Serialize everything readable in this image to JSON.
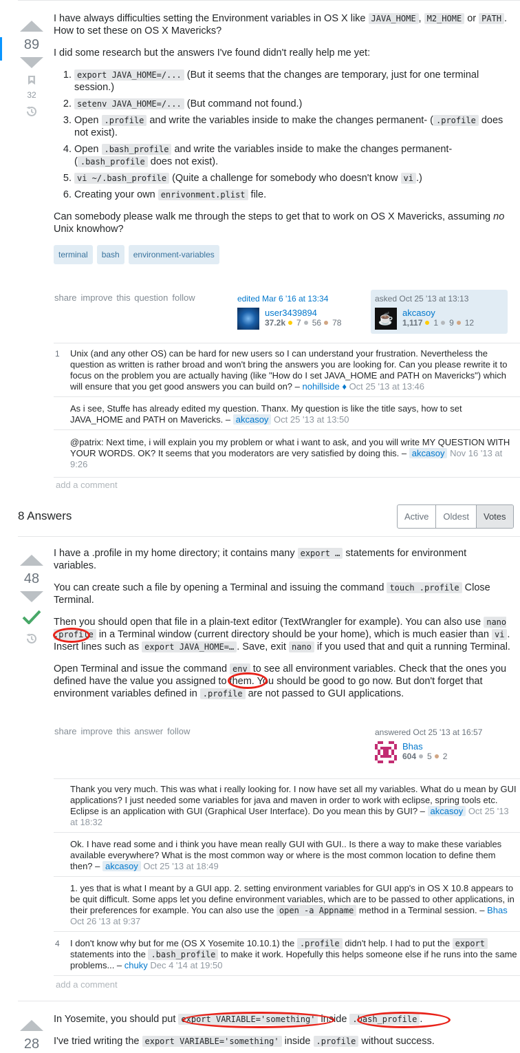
{
  "question": {
    "votes": "89",
    "bookmarks": "32",
    "intro_1": "I have always difficulties setting the Environment variables in OS X like ",
    "intro_code_1": "JAVA_HOME",
    "intro_sep_1": ", ",
    "intro_code_2": "M2_HOME",
    "intro_sep_2": " or ",
    "intro_code_3": "PATH",
    "intro_2": ". How to set these on OS X Mavericks?",
    "research": "I did some research but the answers I've found didn't really help me yet:",
    "steps": [
      {
        "pre": "",
        "code": "export JAVA_HOME=/...",
        "post": " (But it seems that the changes are temporary, just for one terminal session.)"
      },
      {
        "pre": "",
        "code": "setenv JAVA_HOME=/...",
        "post": " (But command not found.)"
      },
      {
        "pre": "Open ",
        "code": ".profile",
        "mid": " and write the variables inside to make the changes permanent- (",
        "code2": ".profile",
        "post": " does not exist)."
      },
      {
        "pre": "Open ",
        "code": ".bash_profile",
        "mid": " and write the variables inside to make the changes permanent- (",
        "code2": ".bash_profile",
        "post": " does not exist)."
      },
      {
        "pre": "",
        "code": "vi ~/.bash_profile",
        "mid": " (Quite a challenge for somebody who doesn't know ",
        "code2": "vi",
        "post": ".)"
      },
      {
        "pre": "Creating your own ",
        "code": "enrivonment.plist",
        "post": " file."
      }
    ],
    "closing_1": "Can somebody please walk me through the steps to get that to work on OS X Mavericks, assuming ",
    "closing_em": "no",
    "closing_2": " Unix knowhow?",
    "tags": [
      "terminal",
      "bash",
      "environment-variables"
    ],
    "menu": [
      "share",
      "improve this question",
      "follow"
    ],
    "edited": {
      "label": "edited Mar 6 '16 at 13:34",
      "user": "user3439894",
      "rep": "37.2k",
      "gold": "7",
      "silver": "56",
      "bronze": "78"
    },
    "asked": {
      "label": "asked Oct 25 '13 at 13:13",
      "user": "akcasoy",
      "rep": "1,117",
      "gold": "1",
      "silver": "9",
      "bronze": "12"
    },
    "comments": [
      {
        "score": "1",
        "text": "Unix (and any other OS) can be hard for new users so I can understand your frustration. Nevertheless the question as written is rather broad and won't bring the answers you are looking for. Can you please rewrite it to focus on the problem you are actually having (like \"How do I set JAVA_HOME and PATH on Mavericks\") which will ensure that you get good answers you can build on? – ",
        "user": "nohillside ♦",
        "date": " Oct 25 '13 at 13:46"
      },
      {
        "score": "",
        "text": "As i see, Stuffe has already edited my question. Thanx. My question is like the title says, how to set JAVA_HOME and PATH on Mavericks. – ",
        "user": "akcasoy",
        "date": " Oct 25 '13 at 13:50"
      },
      {
        "score": "",
        "text": "@patrix: Next time, i will explain you my problem or what i want to ask, and you will write MY QUESTION WITH YOUR WORDS. OK? It seems that you moderators are very satisfied by doing this. – ",
        "user": "akcasoy",
        "date": " Nov 16 '13 at 9:26"
      }
    ],
    "add_comment": "add a comment"
  },
  "answers_header": "8 Answers",
  "sort_tabs": [
    "Active",
    "Oldest",
    "Votes"
  ],
  "answer1": {
    "votes": "48",
    "p1_a": "I have a .profile in my home directory; it contains many ",
    "p1_code": "export …",
    "p1_b": " statements for environment variables.",
    "p2_a": "You can create such a file by opening a Terminal and issuing the command ",
    "p2_code": "touch .profile",
    "p2_b": " Close Terminal.",
    "p3_a": "Then you should open that file in a plain-text editor (TextWrangler for example). You can also use ",
    "p3_code1": "nano .profile",
    "p3_b": " in a Terminal window (current directory should be your home), which is much easier than ",
    "p3_code2": "vi",
    "p3_c": ". Insert lines such as ",
    "p3_code3": "export JAVA_HOME=…",
    "p3_d": ". Save, exit ",
    "p3_code4": "nano",
    "p3_e": " if you used that and quit a running Terminal.",
    "p4_a": "Open Terminal and issue the command ",
    "p4_code1": "env",
    "p4_b": " to see all environment variables. Check that the ones you defined have the value you assigned to them. You should be good to go now. But don't forget that environment variables defined in ",
    "p4_code2": ".profile",
    "p4_c": " are not passed to GUI applications.",
    "menu": [
      "share",
      "improve this answer",
      "follow"
    ],
    "answered": {
      "label": "answered Oct 25 '13 at 16:57",
      "user": "Bhas",
      "rep": "604",
      "silver": "5",
      "bronze": "2"
    },
    "comments": [
      {
        "score": "",
        "text": "Thank you very much. This was what i really looking for. I now have set all my variables. What do u mean by GUI applications? I just needed some variables for java and maven in order to work with eclipse, spring tools etc. Eclipse is an application with GUI (Graphical User Interface). Do you mean this by GUI? – ",
        "user": "akcasoy",
        "date": " Oct 25 '13 at 18:32",
        "tag": true
      },
      {
        "score": "",
        "text": "Ok. I have read some and i think you have mean really GUI with GUI.. Is there a way to make these variables available everywhere? What is the most common way or where is the most common location to define them then? – ",
        "user": "akcasoy",
        "date": " Oct 25 '13 at 18:49",
        "tag": true
      },
      {
        "score": "",
        "text_a": "1. yes that is what I meant by a GUI app. 2. setting environment variables for GUI app's in OS X 10.8 appears to be quit difficult. Some apps let you define environment variables, which are to be passed to other applications, in their preferences for example. You can also use the ",
        "code": "open -a Appname",
        "text_b": " method in a Terminal session. – ",
        "user": "Bhas",
        "date": " Oct 26 '13 at 9:37"
      },
      {
        "score": "4",
        "text_a": "I don't know why but for me (OS X Yosemite 10.10.1) the ",
        "code": ".profile",
        "text_b": " didn't help. I had to put the ",
        "code2": "export",
        "text_c": " statements into the ",
        "code3": ".bash_profile",
        "text_d": " to make it work. Hopefully this helps someone else if he runs into the same problems... – ",
        "user": "chuky",
        "date": " Dec 4 '14 at 19:50"
      }
    ],
    "add_comment": "add a comment"
  },
  "answer2": {
    "votes": "28",
    "p1_a": "In Yosemite, you should put ",
    "p1_code1": "export VARIABLE='something'",
    "p1_b": " inside ",
    "p1_code2": ".bash_profile",
    "p1_c": ".",
    "p2_a": "I've tried writing the ",
    "p2_code1": "export VARIABLE='something'",
    "p2_b": " inside ",
    "p2_code2": ".profile",
    "p2_c": " without success."
  },
  "colors": {
    "accent": "#0077cc",
    "vote_arrow": "#bbc0c4",
    "accepted": "#48a868",
    "highlight_circle": "#e8231a",
    "tag_bg": "#e1ecf4"
  }
}
